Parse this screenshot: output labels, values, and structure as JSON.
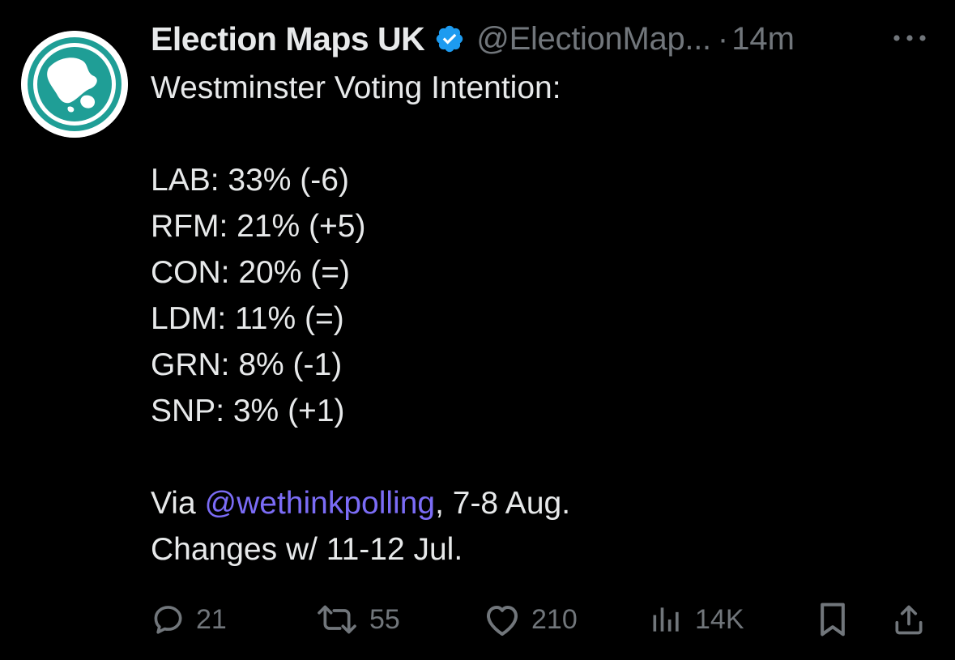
{
  "author": {
    "name": "Election Maps UK",
    "handle": "@ElectionMap...",
    "separator": "·",
    "time": "14m",
    "avatar_icon": "election-maps-globe-logo",
    "verified_icon": "verified-badge-icon"
  },
  "tweet": {
    "heading": "Westminster Voting Intention:",
    "results": [
      "LAB: 33% (-6)",
      "RFM: 21% (+5)",
      "CON: 20% (=)",
      "LDM: 11% (=)",
      "GRN: 8% (-1)",
      "SNP: 3% (+1)"
    ],
    "via_prefix": "Via ",
    "via_mention": "@wethinkpolling",
    "via_suffix": ", 7-8 Aug.",
    "changes": "Changes w/ 11-12 Jul."
  },
  "actions": {
    "replies": "21",
    "reposts": "55",
    "likes": "210",
    "views": "14K"
  },
  "colors": {
    "background": "#000000",
    "text": "#e7e9ea",
    "muted": "#71767b",
    "mention": "#7b6cf6",
    "verified": "#1d9bf0",
    "logo_teal": "#1f9e96"
  }
}
